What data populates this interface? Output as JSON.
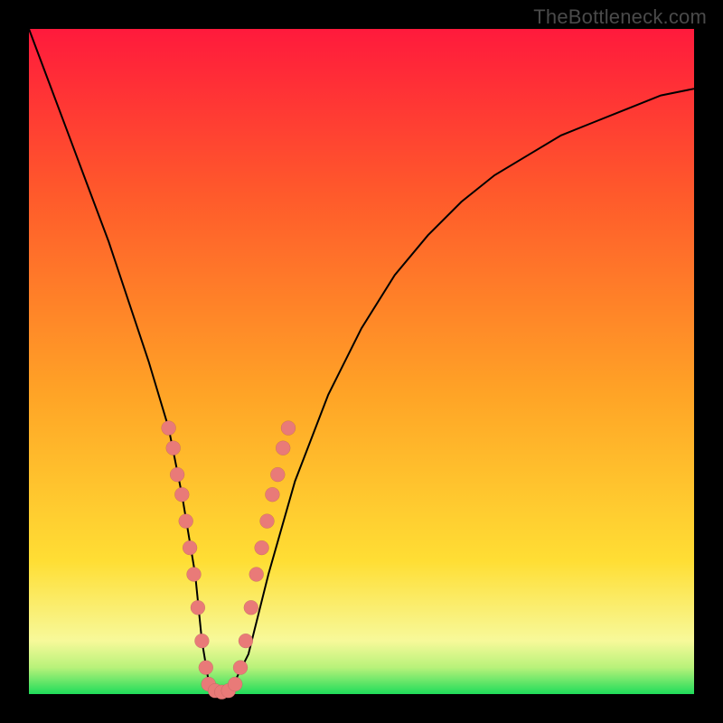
{
  "watermark": "TheBottleneck.com",
  "colors": {
    "gradient": [
      "#ff1a3c",
      "#ff5a2b",
      "#ffa426",
      "#ffde34",
      "#f7f99a",
      "#b8f27a",
      "#1fdc5a"
    ],
    "bead": "#e97a78"
  },
  "chart_data": {
    "type": "line",
    "title": "",
    "xlabel": "",
    "ylabel": "",
    "xlim": [
      0,
      100
    ],
    "ylim": [
      0,
      100
    ],
    "series": [
      {
        "name": "bottleneck-curve",
        "x": [
          0,
          3,
          6,
          9,
          12,
          15,
          18,
          21,
          23,
          25,
          26,
          27,
          28,
          30,
          33,
          36,
          40,
          45,
          50,
          55,
          60,
          65,
          70,
          75,
          80,
          85,
          90,
          95,
          100
        ],
        "y": [
          100,
          92,
          84,
          76,
          68,
          59,
          50,
          40,
          30,
          18,
          8,
          2,
          0,
          0,
          6,
          18,
          32,
          45,
          55,
          63,
          69,
          74,
          78,
          81,
          84,
          86,
          88,
          90,
          91
        ]
      }
    ],
    "annotations": {
      "beads_left": [
        {
          "x": 21,
          "y": 40
        },
        {
          "x": 21.7,
          "y": 37
        },
        {
          "x": 22.3,
          "y": 33
        },
        {
          "x": 23,
          "y": 30
        },
        {
          "x": 23.6,
          "y": 26
        },
        {
          "x": 24.2,
          "y": 22
        },
        {
          "x": 24.8,
          "y": 18
        },
        {
          "x": 25.4,
          "y": 13
        },
        {
          "x": 26,
          "y": 8
        },
        {
          "x": 26.6,
          "y": 4
        }
      ],
      "beads_bottom": [
        {
          "x": 27,
          "y": 1.5
        },
        {
          "x": 28,
          "y": 0.5
        },
        {
          "x": 29,
          "y": 0.3
        },
        {
          "x": 30,
          "y": 0.5
        },
        {
          "x": 31,
          "y": 1.5
        }
      ],
      "beads_right": [
        {
          "x": 31.8,
          "y": 4
        },
        {
          "x": 32.6,
          "y": 8
        },
        {
          "x": 33.4,
          "y": 13
        },
        {
          "x": 34.2,
          "y": 18
        },
        {
          "x": 35,
          "y": 22
        },
        {
          "x": 35.8,
          "y": 26
        },
        {
          "x": 36.6,
          "y": 30
        },
        {
          "x": 37.4,
          "y": 33
        },
        {
          "x": 38.2,
          "y": 37
        },
        {
          "x": 39,
          "y": 40
        }
      ]
    }
  }
}
